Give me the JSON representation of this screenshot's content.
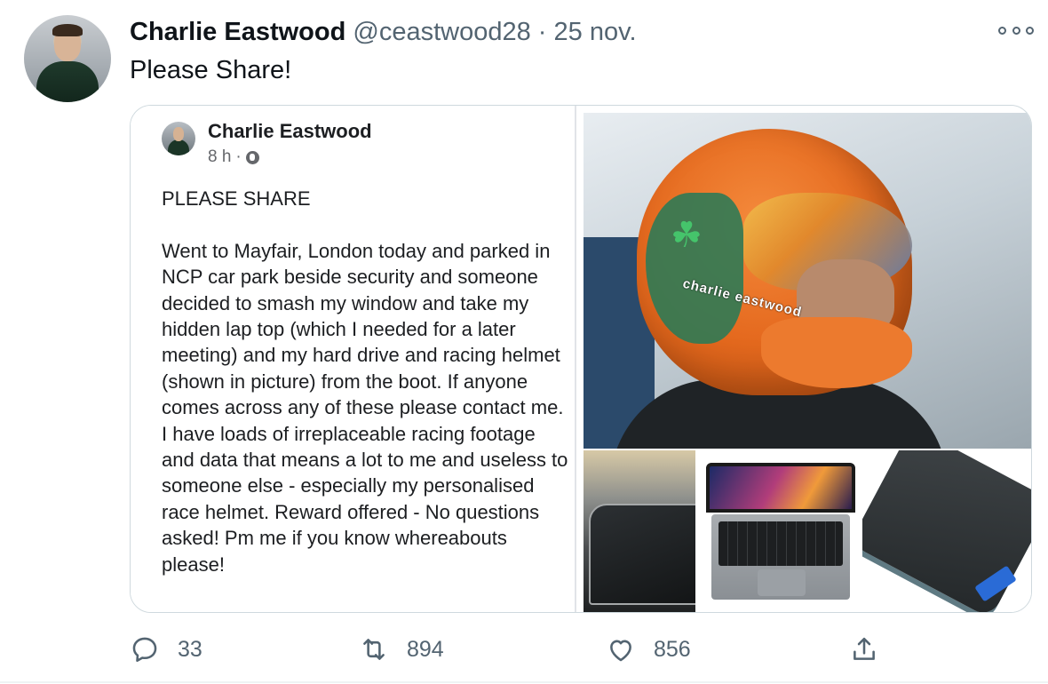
{
  "tweet": {
    "author_name": "Charlie Eastwood",
    "handle": "@ceastwood28",
    "separator": "·",
    "date": "25 nov.",
    "text": "Please Share!"
  },
  "embedded_post": {
    "author_name": "Charlie Eastwood",
    "time": "8 h",
    "separator": "·",
    "heading": "PLEASE SHARE",
    "body": "Went to Mayfair, London today and parked in NCP car park beside security and someone decided to smash my window and take my hidden lap top (which I needed for a later meeting) and my hard drive and racing helmet (shown in picture) from the boot. If anyone comes across any of these please contact me. I have loads of irreplaceable racing footage and data that means a lot to me and useless to someone else - especially my personalised race helmet. Reward offered - No questions asked! Pm me if you know whereabouts please!",
    "helmet_text": "charlie eastwood"
  },
  "actions": {
    "reply_count": "33",
    "retweet_count": "894",
    "like_count": "856"
  },
  "icons": {
    "reply": "reply-icon",
    "retweet": "retweet-icon",
    "like": "heart-icon",
    "share": "share-icon",
    "more": "more-icon",
    "globe": "globe-icon"
  },
  "colors": {
    "text_primary": "#0f1419",
    "text_secondary": "#536471",
    "border": "#cfd9de"
  }
}
